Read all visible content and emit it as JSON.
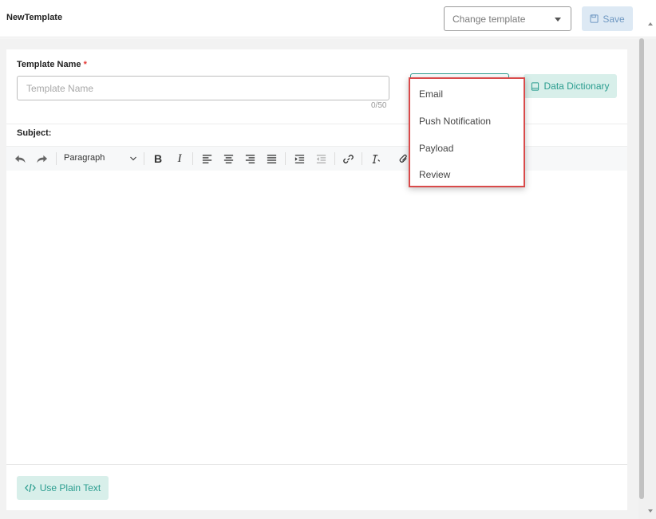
{
  "header": {
    "title": "NewTemplate",
    "change_template_placeholder": "Change template",
    "save_label": "Save"
  },
  "form": {
    "template_name_label": "Template Name",
    "required_marker": "*",
    "template_name_placeholder": "Template Name",
    "template_name_value": "",
    "char_count": "0/50",
    "data_dictionary_label": "Data Dictionary",
    "subject_label": "Subject:"
  },
  "toolbar": {
    "block_format": "Paragraph",
    "tools": [
      "undo-icon",
      "redo-icon",
      "bold-icon",
      "italic-icon",
      "align-left-icon",
      "align-center-icon",
      "align-right-icon",
      "align-justify-icon",
      "indent-icon",
      "outdent-icon",
      "link-icon",
      "clear-format-icon",
      "attachment-icon"
    ]
  },
  "dropdown": {
    "items": [
      "Email",
      "Push Notification",
      "Payload",
      "Review"
    ]
  },
  "footer": {
    "plain_text_label": "Use Plain Text"
  },
  "colors": {
    "accent": "#2a9d8f",
    "accent_bg": "#d8efea",
    "save_text": "#6f98c2",
    "save_bg": "#dde9f4",
    "highlight_border": "#d94a4a",
    "required": "#e53935"
  }
}
